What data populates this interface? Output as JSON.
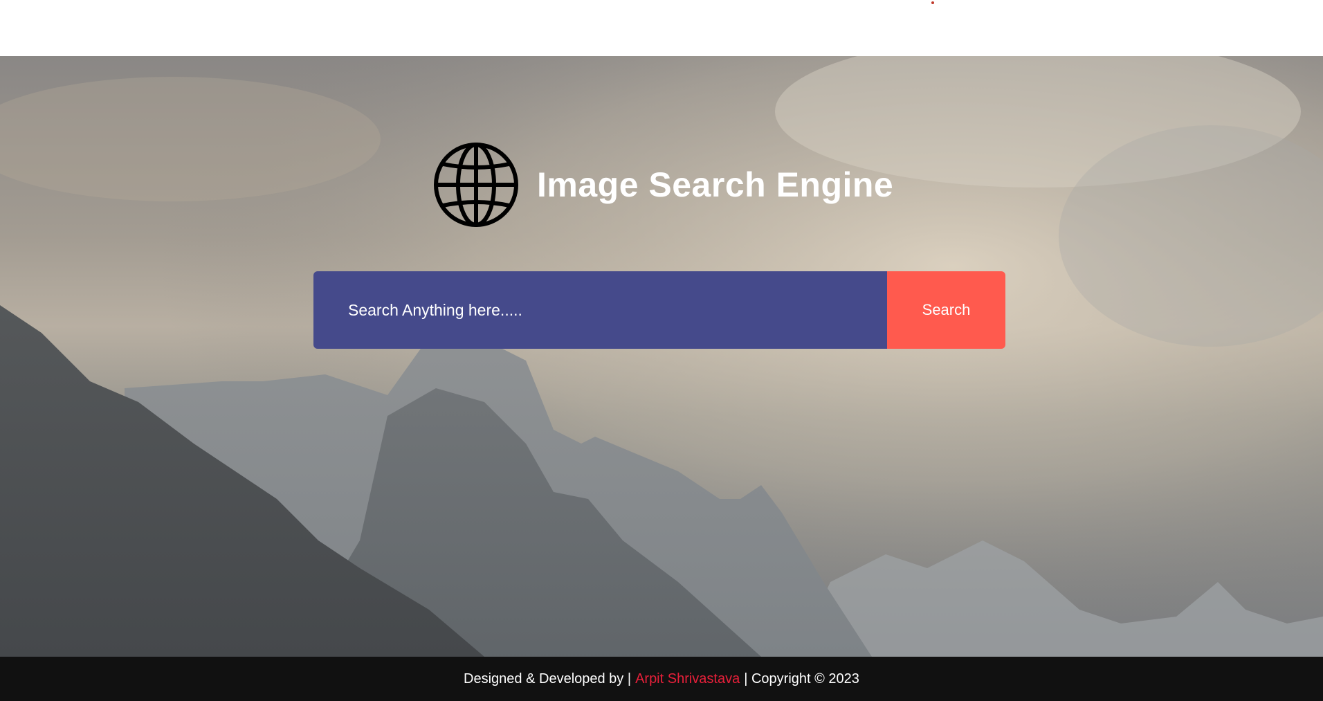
{
  "header": {
    "title": "Image Search Engine",
    "logo_icon": "globe-icon"
  },
  "search": {
    "placeholder": "Search Anything here.....",
    "value": "",
    "button_label": "Search"
  },
  "footer": {
    "prefix": "Designed & Developed by |",
    "author": "Arpit Shrivastava",
    "suffix": "| Copyright © 2023"
  },
  "colors": {
    "search_bg": "#454a8b",
    "button_bg": "#ff5a4e",
    "author_link": "#e8203a",
    "footer_bg": "#111111"
  }
}
